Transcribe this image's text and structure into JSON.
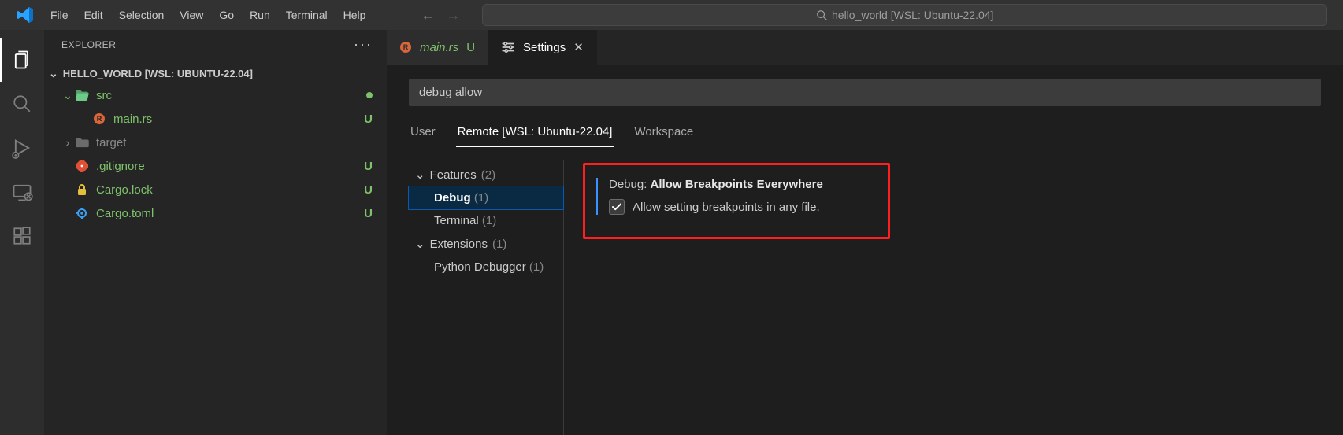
{
  "titlebar": {
    "menu": [
      "File",
      "Edit",
      "Selection",
      "View",
      "Go",
      "Run",
      "Terminal",
      "Help"
    ],
    "command_center": "hello_world [WSL: Ubuntu-22.04]"
  },
  "sidebar": {
    "title": "EXPLORER",
    "folder": "HELLO_WORLD [WSL: UBUNTU-22.04]",
    "tree": [
      {
        "label": "src",
        "kind": "folder-open",
        "indent": 1,
        "chev": "down",
        "color": "green",
        "status_dot": true
      },
      {
        "label": "main.rs",
        "kind": "rust",
        "indent": 2,
        "color": "green",
        "status": "U"
      },
      {
        "label": "target",
        "kind": "folder",
        "indent": 1,
        "chev": "right",
        "color": "muted"
      },
      {
        "label": ".gitignore",
        "kind": "git",
        "indent": 1,
        "color": "green",
        "status": "U"
      },
      {
        "label": "Cargo.lock",
        "kind": "lock",
        "indent": 1,
        "color": "green",
        "status": "U"
      },
      {
        "label": "Cargo.toml",
        "kind": "gear",
        "indent": 1,
        "color": "green",
        "status": "U"
      }
    ]
  },
  "tabs": [
    {
      "label": "main.rs",
      "icon": "rust",
      "status": "U",
      "italic": true,
      "active": false
    },
    {
      "label": "Settings",
      "icon": "settings",
      "closeable": true,
      "active": true
    }
  ],
  "settings": {
    "search_value": "debug allow",
    "scopes": [
      {
        "label": "User",
        "active": false
      },
      {
        "label": "Remote [WSL: Ubuntu-22.04]",
        "active": true
      },
      {
        "label": "Workspace",
        "active": false
      }
    ],
    "toc": [
      {
        "label": "Features",
        "count": "(2)",
        "type": "group"
      },
      {
        "label": "Debug",
        "count": "(1)",
        "type": "item",
        "selected": true
      },
      {
        "label": "Terminal",
        "count": "(1)",
        "type": "item"
      },
      {
        "label": "Extensions",
        "count": "(1)",
        "type": "group"
      },
      {
        "label": "Python Debugger",
        "count": "(1)",
        "type": "item"
      }
    ],
    "item": {
      "category": "Debug:",
      "name": "Allow Breakpoints Everywhere",
      "checked": true,
      "description": "Allow setting breakpoints in any file."
    }
  }
}
